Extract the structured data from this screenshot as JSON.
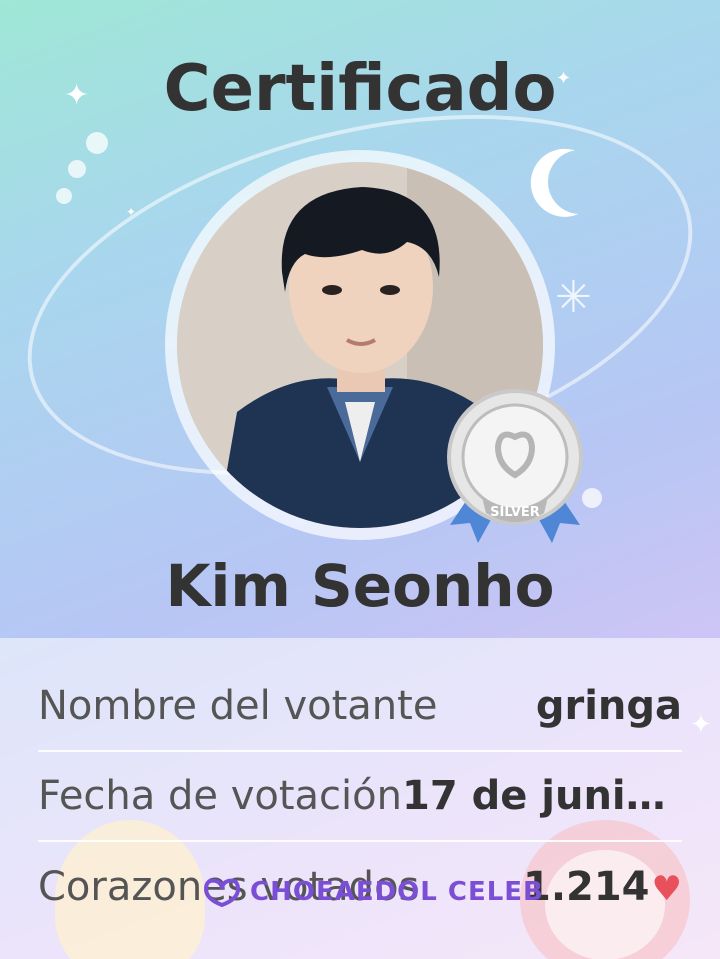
{
  "certificate": {
    "title": "Certificado",
    "celebrity_name": "Kim Seonho",
    "tier_badge": "SILVER",
    "tier_color": "#b8b8b8",
    "ribbon_color": "#4f86d6"
  },
  "details": [
    {
      "label": "Nombre del votante",
      "value": "gringa"
    },
    {
      "label": "Fecha de votación",
      "value": "17 de junio..."
    },
    {
      "label": "Corazones votados",
      "value": "1.214"
    }
  ],
  "brand": {
    "name": "CHOEAEDOL CELEB",
    "accent": "#7a4fd6"
  },
  "icons": {
    "heart": "heart-icon",
    "moon": "moon-icon",
    "sparkle": "sparkle-icon"
  }
}
